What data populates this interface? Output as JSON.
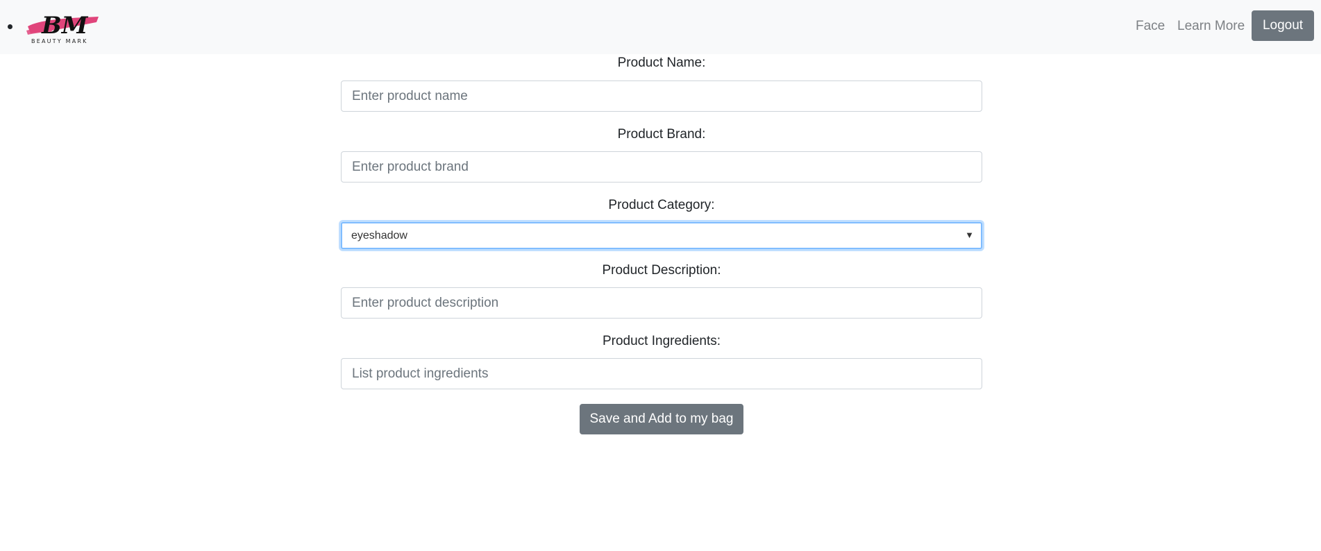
{
  "navbar": {
    "logo_text": "BM",
    "logo_subtext": "BEAUTY MARK",
    "links": [
      "Face",
      "Learn More"
    ],
    "logout_label": "Logout"
  },
  "form": {
    "name_label": "Product Name:",
    "name_placeholder": "Enter product name",
    "brand_label": "Product Brand:",
    "brand_placeholder": "Enter product brand",
    "category_label": "Product Category:",
    "category_value": "eyeshadow",
    "description_label": "Product Description:",
    "description_placeholder": "Enter product description",
    "ingredients_label": "Product Ingredients:",
    "ingredients_placeholder": "List product ingredients",
    "submit_label": "Save and Add to my bag"
  },
  "colors": {
    "navbar_bg": "#f8f9fa",
    "button_bg": "#6c757d",
    "logo_pink": "#e0457b",
    "focus_border": "#80bdff"
  }
}
